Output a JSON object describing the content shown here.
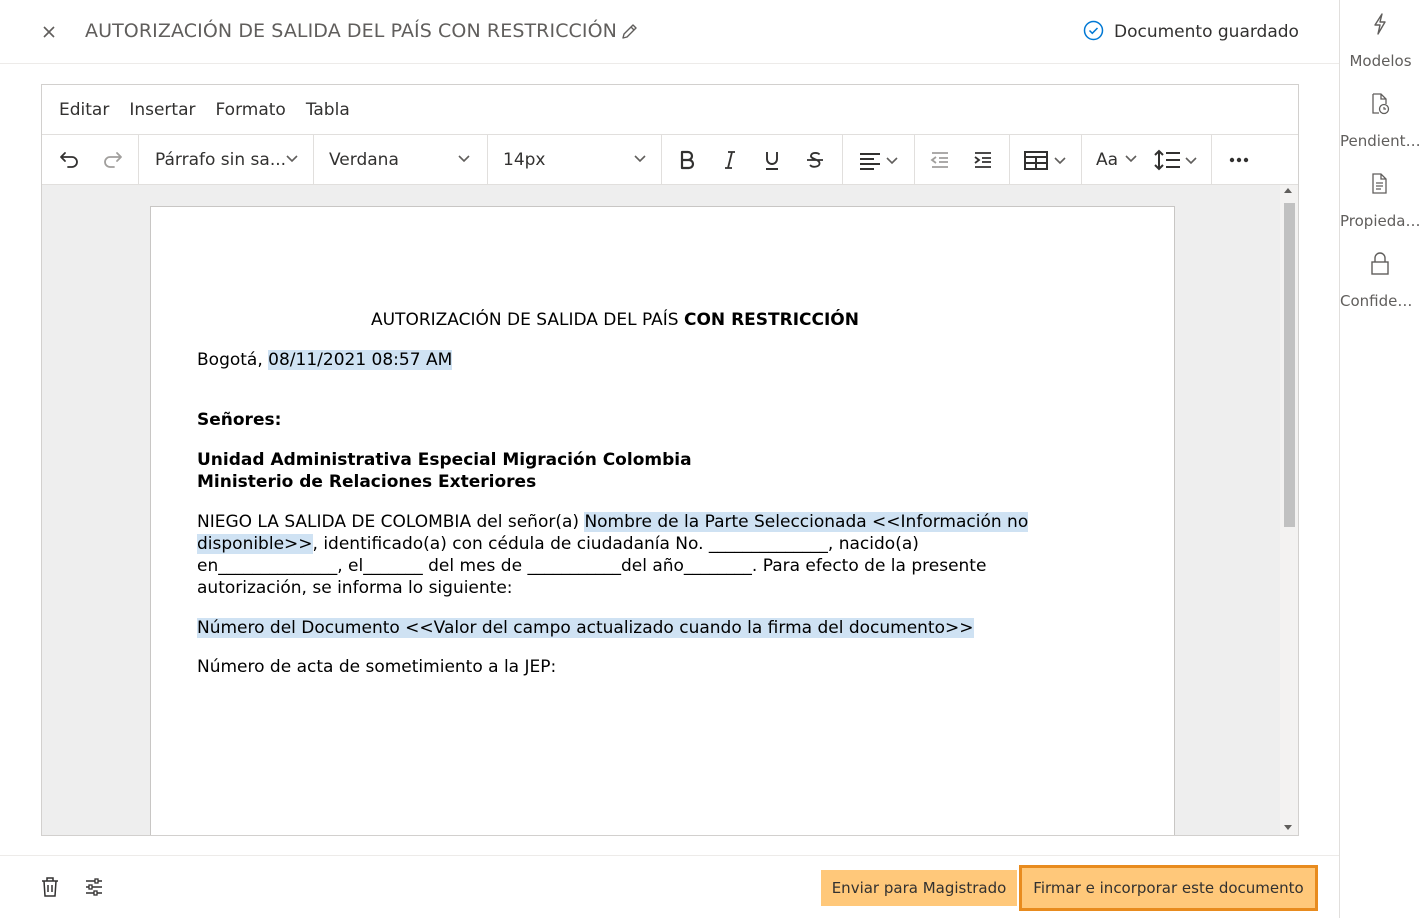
{
  "header": {
    "title": "AUTORIZACIÓN DE SALIDA DEL PAÍS CON RESTRICCIÓN",
    "saved_status": "Documento guardado",
    "icons": [
      "close-icon",
      "pencil-icon",
      "check-circle-icon"
    ]
  },
  "menubar": {
    "items": [
      "Editar",
      "Insertar",
      "Formato",
      "Tabla"
    ]
  },
  "toolbar": {
    "paragraph_style": "Párrafo sin sa...",
    "font_family": "Verdana",
    "font_size": "14px",
    "text_case_label": "Aa",
    "icons": [
      "undo-icon",
      "redo-icon",
      "bold-icon",
      "italic-icon",
      "underline-icon",
      "strikethrough-icon",
      "align-left-icon",
      "outdent-icon",
      "indent-icon",
      "table-icon",
      "line-height-icon",
      "more-icon"
    ]
  },
  "document": {
    "heading_normal": "AUTORIZACIÓN DE SALIDA DEL PAÍS ",
    "heading_bold": "CON RESTRICCIÓN",
    "city": "Bogotá,  ",
    "date": "08/11/2021 08:57 AM",
    "salutation": "Señores:",
    "recipient_1": "Unidad Administrativa Especial Migración Colombia",
    "recipient_2": "Ministerio de Relaciones Exteriores",
    "body_intro": "NIEGO LA SALIDA DE COLOMBIA del señor(a) ",
    "party_field_line1": "Nombre de la Parte Seleccionada <<Información no",
    "party_field_line2": "disponible>>",
    "body_line2_rest": ", identificado(a) con cédula de ciudadanía No. ______________, nacido(a)",
    "body_line3": "en______________, el_______ del mes de ___________del año________. Para efecto de la presente",
    "body_line4": "autorización, se informa lo siguiente:",
    "doc_number_field": "Número del Documento <<Valor del campo actualizado cuando la firma del documento>>",
    "jep_line": "Número de acta de sometimiento a la JEP:"
  },
  "footer": {
    "send_button": "Enviar para Magistrado",
    "sign_button": "Firmar e incorporar este documento",
    "icons": [
      "trash-icon",
      "settings-sliders-icon"
    ]
  },
  "rail": {
    "items": [
      {
        "label": "Modelos",
        "icon": "lightning-icon"
      },
      {
        "label": "Pendientes",
        "icon": "document-clock-icon"
      },
      {
        "label": "Propiedades",
        "icon": "document-list-icon"
      },
      {
        "label": "Confidencialidad",
        "icon": "lock-icon"
      }
    ]
  },
  "colors": {
    "accent_blue": "#0078d4",
    "button_fill": "#ffc87a",
    "button_focus_border": "#e88b1e",
    "field_highlight": "#cfe2f3"
  }
}
